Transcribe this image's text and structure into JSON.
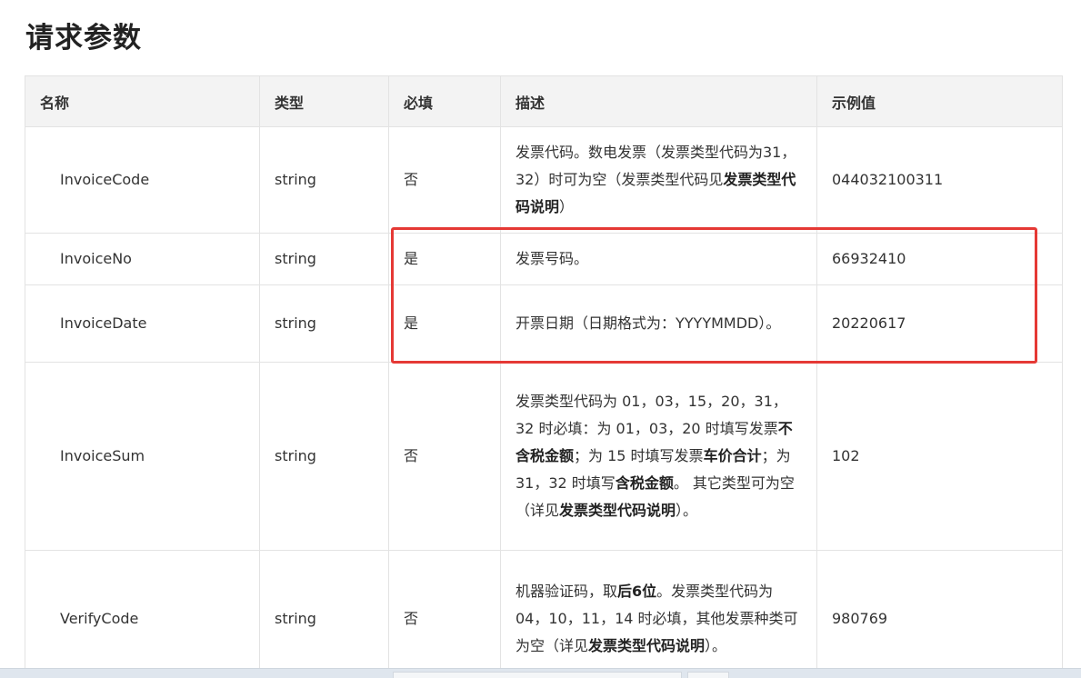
{
  "section_title": "请求参数",
  "table": {
    "headers": [
      "名称",
      "类型",
      "必填",
      "描述",
      "示例值"
    ],
    "rows": [
      {
        "name": "InvoiceCode",
        "type": "string",
        "required": "否",
        "description": [
          {
            "text": "发票代码。数电发票（发票类型代码为31，32）时可为空（发票类型代码见",
            "bold": false
          },
          {
            "text": "发票类型代码说明",
            "bold": true
          },
          {
            "text": "）",
            "bold": false
          }
        ],
        "example": "044032100311"
      },
      {
        "name": "InvoiceNo",
        "type": "string",
        "required": "是",
        "description": [
          {
            "text": "发票号码。",
            "bold": false
          }
        ],
        "example": "66932410"
      },
      {
        "name": "InvoiceDate",
        "type": "string",
        "required": "是",
        "description": [
          {
            "text": "开票日期（日期格式为：YYYYMMDD）。",
            "bold": false
          }
        ],
        "example": "20220617"
      },
      {
        "name": "InvoiceSum",
        "type": "string",
        "required": "否",
        "description": [
          {
            "text": "发票类型代码为 01，03，15，20，31，32 时必填：为 01，03，20 时填写发票",
            "bold": false
          },
          {
            "text": "不含税金额",
            "bold": true
          },
          {
            "text": "；为 15 时填写发票",
            "bold": false
          },
          {
            "text": "车价合计",
            "bold": true
          },
          {
            "text": "；为 31，32 时填写",
            "bold": false
          },
          {
            "text": "含税金额",
            "bold": true
          },
          {
            "text": "。 其它类型可为空（详见",
            "bold": false
          },
          {
            "text": "发票类型代码说明",
            "bold": true
          },
          {
            "text": "）。",
            "bold": false
          }
        ],
        "example": "102"
      },
      {
        "name": "VerifyCode",
        "type": "string",
        "required": "否",
        "description": [
          {
            "text": "机器验证码，取",
            "bold": false
          },
          {
            "text": "后6位",
            "bold": true
          },
          {
            "text": "。发票类型代码为 04，10，11，14 时必填，其他发票种类可为空（详见",
            "bold": false
          },
          {
            "text": "发票类型代码说明",
            "bold": true
          },
          {
            "text": "）。",
            "bold": false
          }
        ],
        "example": "980769"
      }
    ]
  },
  "highlight": {
    "color": "#e53935",
    "highlighted_rows": [
      "InvoiceNo",
      "InvoiceDate"
    ]
  },
  "colors": {
    "header_bg": "#f3f3f3",
    "border": "#e3e3e3",
    "text": "#333333"
  }
}
